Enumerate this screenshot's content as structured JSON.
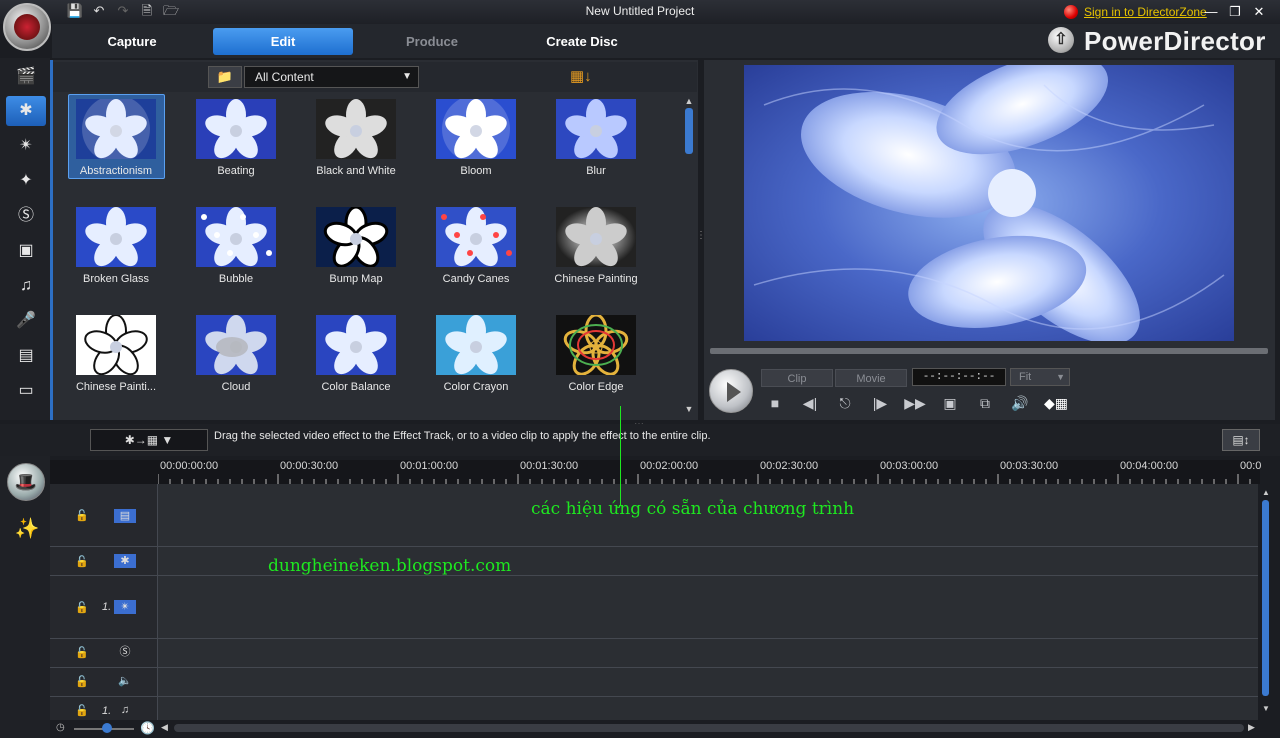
{
  "window": {
    "title": "New Untitled Project",
    "signin_link": "Sign in to DirectorZone",
    "brand": "PowerDirector"
  },
  "nav": {
    "tabs": [
      "Capture",
      "Edit",
      "Produce",
      "Create Disc"
    ],
    "active": "Edit"
  },
  "library": {
    "filter": "All Content",
    "effects": [
      "Abstractionism",
      "Beating",
      "Black and White",
      "Bloom",
      "Blur",
      "Broken Glass",
      "Bubble",
      "Bump Map",
      "Candy Canes",
      "Chinese Painting",
      "Chinese Painti...",
      "Cloud",
      "Color Balance",
      "Color Crayon",
      "Color Edge"
    ],
    "selected": "Abstractionism"
  },
  "preview": {
    "clip_label": "Clip",
    "movie_label": "Movie",
    "timecode": "--:--:--:--",
    "fit_label": "Fit"
  },
  "hint": {
    "text": "Drag the selected video effect to the Effect Track, or to a video clip to apply the effect to the entire clip."
  },
  "timeline": {
    "ruler": [
      "00:00:00:00",
      "00:00:30:00",
      "00:01:00:00",
      "00:01:30:00",
      "00:02:00:00",
      "00:02:30:00",
      "00:03:00:00",
      "00:03:30:00",
      "00:04:00:00",
      "00:0"
    ],
    "track_numbers": [
      "1.",
      "1."
    ]
  },
  "annotations": {
    "effects_note": "các hiệu ứng có sẵn của chương trình",
    "blog": "dungheineken.blogspot.com"
  },
  "colors": {
    "accent_blue": "#2d6fc4",
    "annotation_green": "#1ee820",
    "signin_yellow": "#e8c400"
  }
}
